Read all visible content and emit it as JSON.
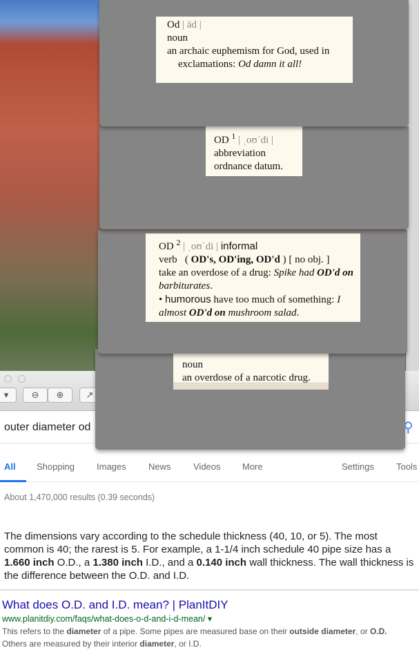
{
  "search": {
    "query": "outer diameter od"
  },
  "tabs": [
    {
      "label": "All"
    },
    {
      "label": "Shopping"
    },
    {
      "label": "Images"
    },
    {
      "label": "News"
    },
    {
      "label": "Videos"
    },
    {
      "label": "More"
    },
    {
      "label": "Settings"
    },
    {
      "label": "Tools"
    }
  ],
  "stats": "About 1,470,000 results (0.39 seconds)",
  "snippet": {
    "p1": "The dimensions vary according to the schedule thickness (40, 10, or 5). The most common is 40; the rarest is 5. For example, a 1-1/4 inch schedule 40 pipe size has a ",
    "b1": "1.660 inch",
    "p2": " O.D., a ",
    "b2": "1.380 inch",
    "p3": " I.D., and a ",
    "b3": "0.140 inch",
    "p4": " wall thickness. The wall thickness is the difference between the O.D. and I.D."
  },
  "result": {
    "title": "What does O.D. and I.D. mean? | PlanItDIY",
    "url": "www.planitdiy.com/faqs/what-does-o-d-and-i-d-mean/ ▾",
    "d1": "This refers to the ",
    "d2": "diameter",
    "d3": " of a pipe. Some pipes are measured base on their ",
    "d4": "outside diameter",
    "d5": ", or ",
    "d6": "O.D.",
    "d7": "Others are measured by their interior ",
    "d8": "diameter",
    "d9": ", or I.D."
  },
  "dict": {
    "e1": {
      "word": "Od",
      "pron": "| äd |",
      "pos": "noun",
      "def": "an archaic euphemism for God, used in",
      "def2": "exclamations: ",
      "ex": "Od damn it all!"
    },
    "e2": {
      "word": "OD",
      "sup": "1",
      "pron": "| ˌoʊˈdi |",
      "pos": "abbreviation",
      "def": "ordnance datum."
    },
    "e3": {
      "word": "OD",
      "sup": "2",
      "pron": "| ˌoʊˈdi |",
      "reg": "informal",
      "pos": "verb",
      "forms": "OD's, OD'ing, OD'd",
      "obj": "[ no obj. ]",
      "def": "take an overdose of a drug: ",
      "ex1": "Spike had ",
      "exb": "OD'd on",
      "ex2": " barbiturates",
      "s2": "humorous",
      "def2": " have too much of something: ",
      "ex3": "I almost ",
      "exb2": "OD'd on",
      "ex4": " mushroom salad"
    },
    "e4": {
      "pos": "noun",
      "def": "an overdose of a narcotic drug."
    }
  }
}
